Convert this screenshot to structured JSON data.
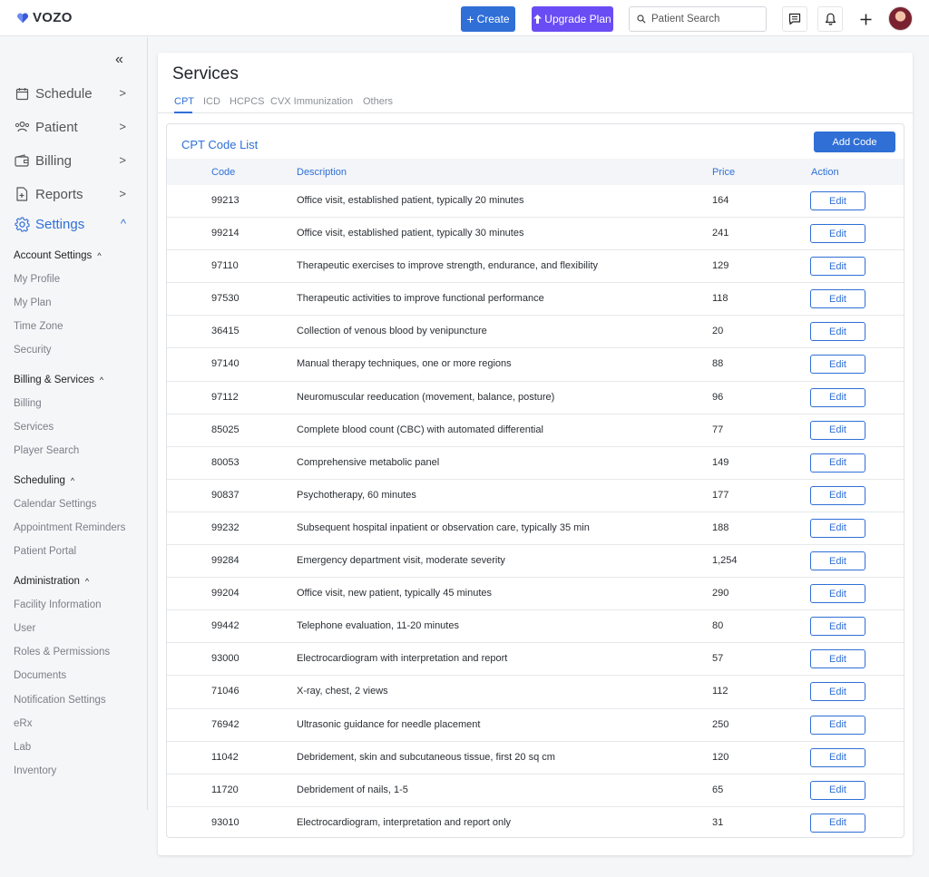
{
  "app": {
    "logo_text": "VOZO"
  },
  "header": {
    "create_label": "Create",
    "upgrade_label": "Upgrade Plan",
    "search_placeholder": "Patient Search",
    "colors": {
      "create": "#2f6fd6",
      "upgrade": "#6a4cf4"
    }
  },
  "sidebar": {
    "nav": [
      {
        "label": "Schedule",
        "icon": "calendar-icon"
      },
      {
        "label": "Patient",
        "icon": "users-icon"
      },
      {
        "label": "Billing",
        "icon": "wallet-icon"
      },
      {
        "label": "Reports",
        "icon": "report-icon"
      },
      {
        "label": "Settings",
        "icon": "gear-icon",
        "active": true
      }
    ],
    "sections": [
      {
        "title": "Account Settings",
        "items": [
          "My Profile",
          "My Plan",
          "Time Zone",
          "Security"
        ]
      },
      {
        "title": "Billing & Services",
        "items": [
          "Billing",
          "Services",
          "Player Search"
        ]
      },
      {
        "title": "Scheduling",
        "items": [
          "Calendar Settings",
          "Appointment Reminders",
          "Patient Portal"
        ]
      },
      {
        "title": "Administration",
        "items": [
          "Facility Information",
          "User",
          "Roles & Permissions",
          "Documents",
          "Notification Settings",
          "eRx",
          "Lab",
          "Inventory"
        ]
      }
    ]
  },
  "main": {
    "title": "Services",
    "tabs": [
      "CPT",
      "ICD",
      "HCPCS",
      "CVX Immunization",
      "Others"
    ],
    "active_tab": "CPT",
    "list_title": "CPT Code List",
    "add_button": "Add Code",
    "columns": {
      "code": "Code",
      "description": "Description",
      "price": "Price",
      "action": "Action"
    },
    "edit_label": "Edit",
    "rows": [
      {
        "code": "99213",
        "description": "Office visit, established patient, typically 20 minutes",
        "price": "164"
      },
      {
        "code": "99214",
        "description": "Office visit, established patient, typically 30 minutes",
        "price": "241"
      },
      {
        "code": "97110",
        "description": "Therapeutic exercises to improve strength, endurance, and flexibility",
        "price": "129"
      },
      {
        "code": "97530",
        "description": "Therapeutic activities to improve functional performance",
        "price": "118"
      },
      {
        "code": "36415",
        "description": "Collection of venous blood by venipuncture",
        "price": "20"
      },
      {
        "code": "97140",
        "description": "Manual therapy techniques, one or more regions",
        "price": "88"
      },
      {
        "code": "97112",
        "description": "Neuromuscular reeducation (movement, balance, posture)",
        "price": "96"
      },
      {
        "code": "85025",
        "description": "Complete blood count (CBC) with automated differential",
        "price": "77"
      },
      {
        "code": "80053",
        "description": "Comprehensive metabolic panel",
        "price": "149"
      },
      {
        "code": "90837",
        "description": "Psychotherapy, 60 minutes",
        "price": "177"
      },
      {
        "code": "99232",
        "description": "Subsequent hospital inpatient or observation care, typically 35 min",
        "price": "188"
      },
      {
        "code": "99284",
        "description": "Emergency department visit, moderate severity",
        "price": "1,254"
      },
      {
        "code": "99204",
        "description": "Office visit, new patient, typically 45 minutes",
        "price": "290"
      },
      {
        "code": "99442",
        "description": "Telephone evaluation, 11-20 minutes",
        "price": "80"
      },
      {
        "code": "93000",
        "description": "Electrocardiogram with interpretation and report",
        "price": "57"
      },
      {
        "code": "71046",
        "description": "X-ray, chest, 2 views",
        "price": "112"
      },
      {
        "code": "76942",
        "description": "Ultrasonic guidance for needle placement",
        "price": "250"
      },
      {
        "code": "11042",
        "description": "Debridement, skin and subcutaneous tissue, first 20 sq cm",
        "price": "120"
      },
      {
        "code": "11720",
        "description": "Debridement of nails, 1-5",
        "price": "65"
      },
      {
        "code": "93010",
        "description": "Electrocardiogram, interpretation and report only",
        "price": "31"
      }
    ]
  }
}
